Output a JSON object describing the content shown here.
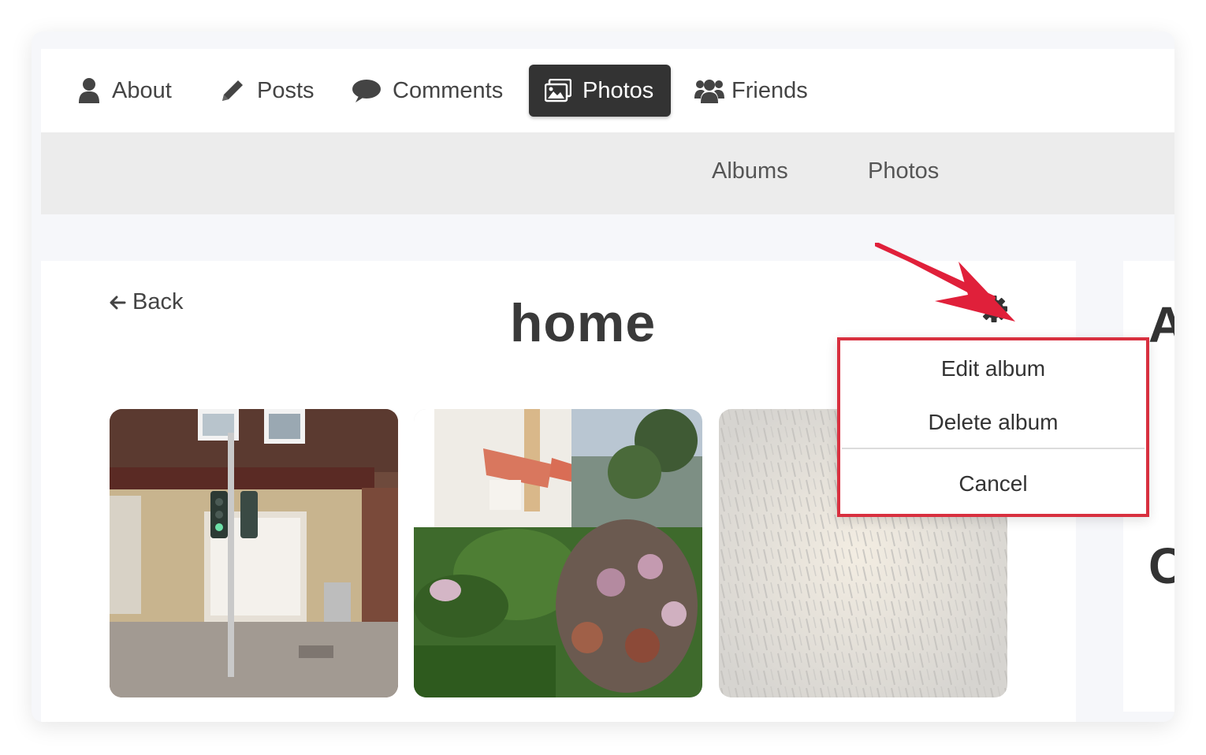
{
  "nav": {
    "items": [
      {
        "label": "About",
        "icon": "user-icon"
      },
      {
        "label": "Posts",
        "icon": "pencil-icon"
      },
      {
        "label": "Comments",
        "icon": "comment-icon"
      },
      {
        "label": "Photos",
        "icon": "images-icon",
        "active": true
      },
      {
        "label": "Friends",
        "icon": "users-icon"
      }
    ]
  },
  "subnav": {
    "items": [
      {
        "label": "Albums"
      },
      {
        "label": "Photos"
      }
    ]
  },
  "album": {
    "back_label": "Back",
    "title": "home",
    "photos": [
      {
        "subject": "street corner with traffic light and brick building"
      },
      {
        "subject": "house garden with hydrangeas and red awnings"
      },
      {
        "subject": "white textured wall"
      }
    ]
  },
  "settings_menu": {
    "items": [
      {
        "label": "Edit album"
      },
      {
        "label": "Delete album"
      },
      {
        "label": "Cancel"
      }
    ]
  },
  "side_panel": {
    "letters": [
      "A",
      "C"
    ]
  },
  "colors": {
    "active_tab_bg": "#333333",
    "highlight_border": "#d8303f",
    "annotation_arrow": "#e0203a"
  }
}
